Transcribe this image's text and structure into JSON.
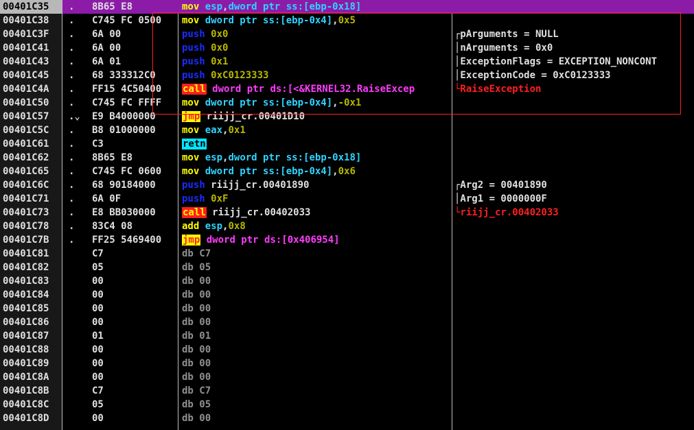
{
  "colors": {
    "selected_row": "#8c1ca8",
    "highlight_box": "#ff2020",
    "call_bg": "#ff1e1e",
    "jmp_bg": "#ffff00",
    "retn_bg": "#00e5ff"
  },
  "rows": [
    {
      "addr": "00401C35",
      "mark": ".",
      "hex": "8B65 E8",
      "op": "mov",
      "op_class": "op-mov",
      "args": [
        {
          "t": "esp",
          "c": "arg-reg"
        },
        {
          "t": ",",
          "c": "arg-plain"
        },
        {
          "t": "dword ptr ss:[ebp-0x18]",
          "c": "arg-mem"
        }
      ],
      "comment": "",
      "comment_class": "",
      "selected": true
    },
    {
      "addr": "00401C38",
      "mark": ".",
      "hex": "C745 FC 0500",
      "op": "mov",
      "op_class": "op-mov",
      "args": [
        {
          "t": "dword ptr ss:[ebp-0x4]",
          "c": "arg-mem"
        },
        {
          "t": ",",
          "c": "arg-plain"
        },
        {
          "t": "0x5",
          "c": "arg-imm"
        }
      ],
      "comment": "",
      "comment_class": "",
      "selected": false
    },
    {
      "addr": "00401C3F",
      "mark": ".",
      "hex": "6A 00",
      "op": "push",
      "op_class": "op-push",
      "args": [
        {
          "t": "0x0",
          "c": "arg-imm"
        }
      ],
      "comment": "┌pArguments = NULL",
      "comment_class": "",
      "selected": false
    },
    {
      "addr": "00401C41",
      "mark": ".",
      "hex": "6A 00",
      "op": "push",
      "op_class": "op-push",
      "args": [
        {
          "t": "0x0",
          "c": "arg-imm"
        }
      ],
      "comment": "│nArguments = 0x0",
      "comment_class": "",
      "selected": false
    },
    {
      "addr": "00401C43",
      "mark": ".",
      "hex": "6A 01",
      "op": "push",
      "op_class": "op-push",
      "args": [
        {
          "t": "0x1",
          "c": "arg-imm"
        }
      ],
      "comment": "│ExceptionFlags = EXCEPTION_NONCONT",
      "comment_class": "",
      "selected": false
    },
    {
      "addr": "00401C45",
      "mark": ".",
      "hex": "68 333312C0",
      "op": "push",
      "op_class": "op-push",
      "args": [
        {
          "t": "0xC0123333",
          "c": "arg-imm"
        }
      ],
      "comment": "│ExceptionCode = 0xC0123333",
      "comment_class": "",
      "selected": false
    },
    {
      "addr": "00401C4A",
      "mark": ".",
      "hex": "FF15 4C50400",
      "op": "call",
      "op_class": "op-call",
      "args": [
        {
          "t": "dword ptr ds:[<&KERNEL32.RaiseExcep",
          "c": "arg-mem-magenta"
        }
      ],
      "comment": "└RaiseException",
      "comment_class": "comment-red",
      "selected": false
    },
    {
      "addr": "00401C50",
      "mark": ".",
      "hex": "C745 FC FFFF",
      "op": "mov",
      "op_class": "op-mov",
      "args": [
        {
          "t": "dword ptr ss:[ebp-0x4]",
          "c": "arg-mem"
        },
        {
          "t": ",",
          "c": "arg-plain"
        },
        {
          "t": "-0x1",
          "c": "arg-imm"
        }
      ],
      "comment": "",
      "comment_class": "",
      "selected": false
    },
    {
      "addr": "00401C57",
      "mark": ".⌄",
      "hex": "E9 B4000000",
      "op": "jmp",
      "op_class": "op-jmp",
      "args": [
        {
          "t": "riijj_cr.00401D10",
          "c": "arg-plain"
        }
      ],
      "comment": "",
      "comment_class": "",
      "selected": false
    },
    {
      "addr": "00401C5C",
      "mark": ".",
      "hex": "B8 01000000",
      "op": "mov",
      "op_class": "op-mov",
      "args": [
        {
          "t": "eax",
          "c": "arg-reg"
        },
        {
          "t": ",",
          "c": "arg-plain"
        },
        {
          "t": "0x1",
          "c": "arg-imm"
        }
      ],
      "comment": "",
      "comment_class": "",
      "selected": false
    },
    {
      "addr": "00401C61",
      "mark": ".",
      "hex": "C3",
      "op": "retn",
      "op_class": "op-retn",
      "args": [],
      "comment": "",
      "comment_class": "",
      "selected": false
    },
    {
      "addr": "00401C62",
      "mark": ".",
      "hex": "8B65 E8",
      "op": "mov",
      "op_class": "op-mov",
      "args": [
        {
          "t": "esp",
          "c": "arg-reg"
        },
        {
          "t": ",",
          "c": "arg-plain"
        },
        {
          "t": "dword ptr ss:[ebp-0x18]",
          "c": "arg-mem"
        }
      ],
      "comment": "",
      "comment_class": "",
      "selected": false
    },
    {
      "addr": "00401C65",
      "mark": ".",
      "hex": "C745 FC 0600",
      "op": "mov",
      "op_class": "op-mov",
      "args": [
        {
          "t": "dword ptr ss:[ebp-0x4]",
          "c": "arg-mem"
        },
        {
          "t": ",",
          "c": "arg-plain"
        },
        {
          "t": "0x6",
          "c": "arg-imm"
        }
      ],
      "comment": "",
      "comment_class": "",
      "selected": false
    },
    {
      "addr": "00401C6C",
      "mark": ".",
      "hex": "68 90184000",
      "op": "push",
      "op_class": "op-push",
      "args": [
        {
          "t": "riijj_cr.00401890",
          "c": "arg-plain"
        }
      ],
      "comment": "┌Arg2 = 00401890",
      "comment_class": "",
      "selected": false
    },
    {
      "addr": "00401C71",
      "mark": ".",
      "hex": "6A 0F",
      "op": "push",
      "op_class": "op-push",
      "args": [
        {
          "t": "0xF",
          "c": "arg-imm"
        }
      ],
      "comment": "│Arg1 = 0000000F",
      "comment_class": "",
      "selected": false
    },
    {
      "addr": "00401C73",
      "mark": ".",
      "hex": "E8 BB030000",
      "op": "call",
      "op_class": "op-call",
      "args": [
        {
          "t": "riijj_cr.00402033",
          "c": "arg-plain"
        }
      ],
      "comment": "└riijj_cr.00402033",
      "comment_class": "comment-red",
      "selected": false
    },
    {
      "addr": "00401C78",
      "mark": ".",
      "hex": "83C4 08",
      "op": "add",
      "op_class": "op-add",
      "args": [
        {
          "t": "esp",
          "c": "arg-reg"
        },
        {
          "t": ",",
          "c": "arg-plain"
        },
        {
          "t": "0x8",
          "c": "arg-imm"
        }
      ],
      "comment": "",
      "comment_class": "",
      "selected": false
    },
    {
      "addr": "00401C7B",
      "mark": ".",
      "hex": "FF25 5469400",
      "op": "jmp",
      "op_class": "op-jmp",
      "args": [
        {
          "t": "dword ptr ds:[0x406954]",
          "c": "arg-mem-magenta"
        }
      ],
      "comment": "",
      "comment_class": "",
      "selected": false
    },
    {
      "addr": "00401C81",
      "mark": "",
      "hex": "C7",
      "op": "db",
      "op_class": "op-db",
      "args": [
        {
          "t": "C7",
          "c": "op-db"
        }
      ],
      "comment": "",
      "comment_class": "",
      "selected": false
    },
    {
      "addr": "00401C82",
      "mark": "",
      "hex": "05",
      "op": "db",
      "op_class": "op-db",
      "args": [
        {
          "t": "05",
          "c": "op-db"
        }
      ],
      "comment": "",
      "comment_class": "",
      "selected": false
    },
    {
      "addr": "00401C83",
      "mark": "",
      "hex": "00",
      "op": "db",
      "op_class": "op-db",
      "args": [
        {
          "t": "00",
          "c": "op-db"
        }
      ],
      "comment": "",
      "comment_class": "",
      "selected": false
    },
    {
      "addr": "00401C84",
      "mark": "",
      "hex": "00",
      "op": "db",
      "op_class": "op-db",
      "args": [
        {
          "t": "00",
          "c": "op-db"
        }
      ],
      "comment": "",
      "comment_class": "",
      "selected": false
    },
    {
      "addr": "00401C85",
      "mark": "",
      "hex": "00",
      "op": "db",
      "op_class": "op-db",
      "args": [
        {
          "t": "00",
          "c": "op-db"
        }
      ],
      "comment": "",
      "comment_class": "",
      "selected": false
    },
    {
      "addr": "00401C86",
      "mark": "",
      "hex": "00",
      "op": "db",
      "op_class": "op-db",
      "args": [
        {
          "t": "00",
          "c": "op-db"
        }
      ],
      "comment": "",
      "comment_class": "",
      "selected": false
    },
    {
      "addr": "00401C87",
      "mark": "",
      "hex": "01",
      "op": "db",
      "op_class": "op-db",
      "args": [
        {
          "t": "01",
          "c": "op-db"
        }
      ],
      "comment": "",
      "comment_class": "",
      "selected": false
    },
    {
      "addr": "00401C88",
      "mark": "",
      "hex": "00",
      "op": "db",
      "op_class": "op-db",
      "args": [
        {
          "t": "00",
          "c": "op-db"
        }
      ],
      "comment": "",
      "comment_class": "",
      "selected": false
    },
    {
      "addr": "00401C89",
      "mark": "",
      "hex": "00",
      "op": "db",
      "op_class": "op-db",
      "args": [
        {
          "t": "00",
          "c": "op-db"
        }
      ],
      "comment": "",
      "comment_class": "",
      "selected": false
    },
    {
      "addr": "00401C8A",
      "mark": "",
      "hex": "00",
      "op": "db",
      "op_class": "op-db",
      "args": [
        {
          "t": "00",
          "c": "op-db"
        }
      ],
      "comment": "",
      "comment_class": "",
      "selected": false
    },
    {
      "addr": "00401C8B",
      "mark": "",
      "hex": "C7",
      "op": "db",
      "op_class": "op-db",
      "args": [
        {
          "t": "C7",
          "c": "op-db"
        }
      ],
      "comment": "",
      "comment_class": "",
      "selected": false
    },
    {
      "addr": "00401C8C",
      "mark": "",
      "hex": "05",
      "op": "db",
      "op_class": "op-db",
      "args": [
        {
          "t": "05",
          "c": "op-db"
        }
      ],
      "comment": "",
      "comment_class": "",
      "selected": false
    },
    {
      "addr": "00401C8D",
      "mark": "",
      "hex": "00",
      "op": "db",
      "op_class": "op-db",
      "args": [
        {
          "t": "00",
          "c": "op-db"
        }
      ],
      "comment": "",
      "comment_class": "",
      "selected": false
    }
  ]
}
